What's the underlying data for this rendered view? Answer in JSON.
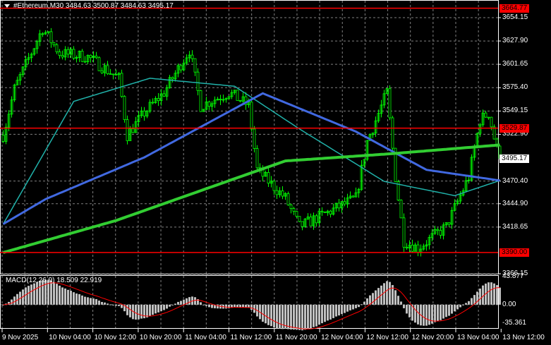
{
  "header": {
    "title": "#Ethereum,M30  3484.63 3500.87 3484.63 3495.17"
  },
  "price_axis": {
    "ticks": [
      "3654.15",
      "3627.90",
      "3601.65",
      "3575.40",
      "3549.15",
      "3522.90",
      "3470.40",
      "3444.90",
      "3418.65",
      "3366.15"
    ],
    "tick_values": [
      3654.15,
      3627.9,
      3601.65,
      3575.4,
      3549.15,
      3522.9,
      3470.4,
      3444.9,
      3418.65,
      3366.15
    ],
    "levels": [
      {
        "label": "3664.77",
        "value": 3664.77
      },
      {
        "label": "3529.87",
        "value": 3529.87
      },
      {
        "label": "3390.00",
        "value": 3390.0
      }
    ],
    "current": {
      "label": "3495.17",
      "value": 3495.17
    }
  },
  "time_axis": {
    "labels": [
      "9 Nov 2025",
      "10 Nov 04:00",
      "10 Nov 12:00",
      "10 Nov 20:00",
      "11 Nov 04:00",
      "11 Nov 12:00",
      "11 Nov 20:00",
      "12 Nov 04:00",
      "12 Nov 12:00",
      "12 Nov 20:00",
      "13 Nov 04:00",
      "13 Nov 12:00"
    ]
  },
  "macd": {
    "label": "MACD(12,26,9) 18.509 22.919",
    "ticks": [
      "43.877",
      "0.00",
      "-35.361"
    ],
    "max": 43.877,
    "min": -35.361
  },
  "colors": {
    "bull": "#00ff00",
    "level": "#ff0000",
    "ma_slow": "#32cd32",
    "ma_mid": "#4169e1",
    "ma_fast": "#20b2aa",
    "grid": "#808080",
    "hist": "#c0c0c0",
    "signal": "#ff0000"
  },
  "series": {
    "price_keypoints": [
      [
        0,
        3522
      ],
      [
        4,
        3574
      ],
      [
        14,
        3642
      ],
      [
        20,
        3614
      ],
      [
        30,
        3610
      ],
      [
        41,
        3586
      ],
      [
        44,
        3522
      ],
      [
        50,
        3547
      ],
      [
        57,
        3570
      ],
      [
        66,
        3618
      ],
      [
        70,
        3555
      ],
      [
        80,
        3570
      ],
      [
        87,
        3555
      ],
      [
        90,
        3483
      ],
      [
        100,
        3451
      ],
      [
        105,
        3419
      ],
      [
        115,
        3435
      ],
      [
        125,
        3451
      ],
      [
        129,
        3515
      ],
      [
        136,
        3570
      ],
      [
        139,
        3475
      ],
      [
        142,
        3403
      ],
      [
        147,
        3395
      ],
      [
        157,
        3419
      ],
      [
        165,
        3475
      ],
      [
        169,
        3539
      ],
      [
        172,
        3547
      ],
      [
        176,
        3491
      ]
    ],
    "ma_slow_keypoints": [
      [
        0,
        3390
      ],
      [
        40,
        3426
      ],
      [
        82,
        3473
      ],
      [
        100,
        3493
      ],
      [
        137,
        3501
      ],
      [
        176,
        3511
      ]
    ],
    "ma_mid_keypoints": [
      [
        0,
        3422
      ],
      [
        15,
        3450
      ],
      [
        50,
        3497
      ],
      [
        92,
        3569
      ],
      [
        125,
        3526
      ],
      [
        150,
        3483
      ],
      [
        176,
        3471
      ]
    ],
    "ma_fast_keypoints": [
      [
        0,
        3422
      ],
      [
        25,
        3560
      ],
      [
        52,
        3586
      ],
      [
        82,
        3577
      ],
      [
        105,
        3529
      ],
      [
        135,
        3470
      ],
      [
        160,
        3454
      ],
      [
        176,
        3471
      ]
    ]
  }
}
